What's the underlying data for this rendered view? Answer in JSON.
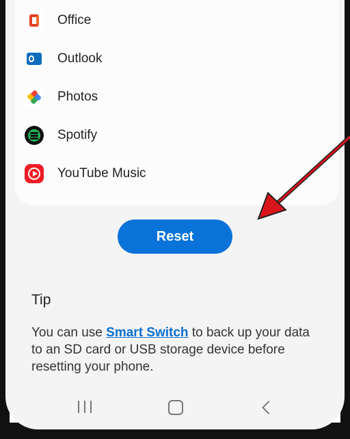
{
  "apps": [
    {
      "label": "Office",
      "icon": "office-icon"
    },
    {
      "label": "Outlook",
      "icon": "outlook-icon"
    },
    {
      "label": "Photos",
      "icon": "photos-icon"
    },
    {
      "label": "Spotify",
      "icon": "spotify-icon"
    },
    {
      "label": "YouTube Music",
      "icon": "youtube-music-icon"
    }
  ],
  "reset_button": {
    "label": "Reset",
    "color": "#0a73d9"
  },
  "tip": {
    "title": "Tip",
    "text_before": "You can use ",
    "link": "Smart Switch",
    "text_after": " to back up your data to an SD card or USB storage device before resetting your phone."
  },
  "nav": {
    "recent": "recent-apps-icon",
    "home": "home-icon",
    "back": "back-icon"
  },
  "annotation": {
    "arrow_color": "#d9141b"
  }
}
